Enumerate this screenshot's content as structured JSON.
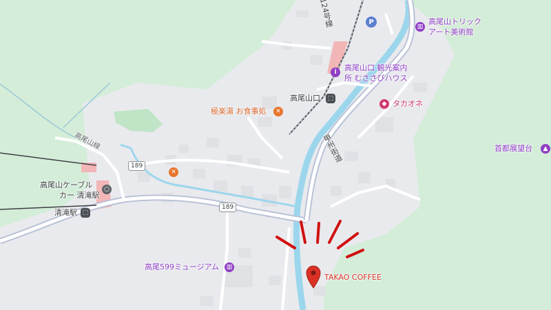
{
  "map": {
    "destination": {
      "name": "TAKAO COFFEE",
      "pin_color": "#d93025"
    },
    "pois": {
      "trick_art_line1": "高尾山トリック",
      "trick_art_line2": "アート美術館",
      "tourist_info_line1": "高尾山口 観光案内",
      "tourist_info_line2": "所 むささびハウス",
      "takaoone": "タカオネ",
      "gokuraku": "極楽湯 お食事処",
      "shuto_tenbodai": "首都展望台",
      "cable_line1": "高尾山ケーブル",
      "cable_line2": "カー 清滝駅",
      "museum_599": "高尾599ミュージアム"
    },
    "stations": {
      "takaosanguchi": "高尾山口",
      "kiyotaki": "清滝駅"
    },
    "roads": {
      "route_189": "189",
      "route_189_b": "189",
      "koshu_kaido": "甲州街道",
      "takaosan_line": "高尾山線",
      "route_124": "124号線"
    },
    "parking_label": "P",
    "colors": {
      "forest": "#d4edd9",
      "urban": "#e9eaee",
      "road": "#ffffff",
      "highway": "#b9c3d6",
      "river": "#9cd6ec",
      "rail": "#4a4f55",
      "station_area": "#f2b6b6",
      "poi_purple": "#8f3fc5",
      "poi_orange": "#d4662a",
      "poi_pink": "#d1386f",
      "annotation": "#d01010"
    }
  }
}
